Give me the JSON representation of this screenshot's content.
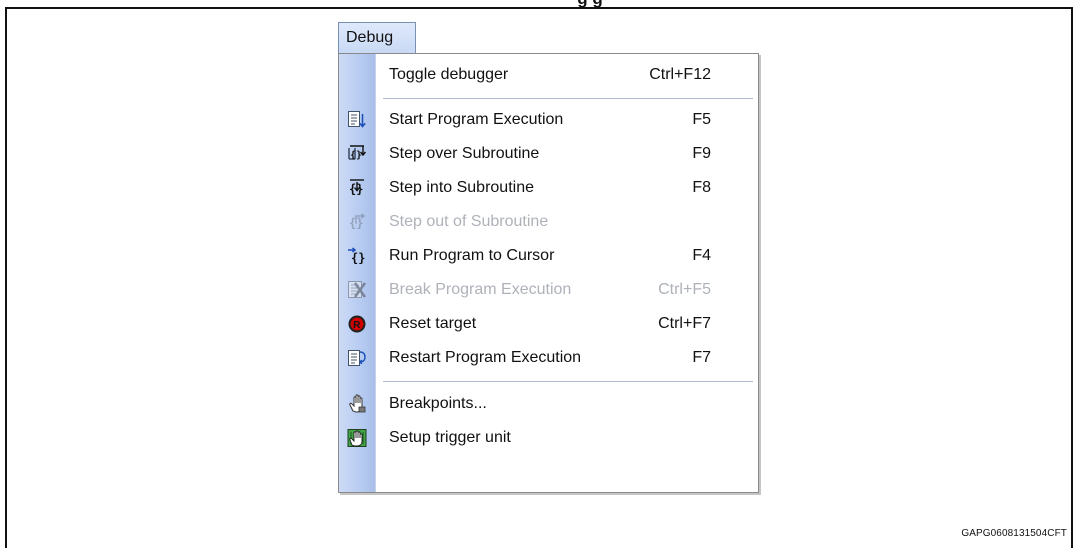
{
  "figure": {
    "top_text": "g   g",
    "caption": "GAPG0608131504CFT"
  },
  "menu": {
    "title": "Debug",
    "items": [
      {
        "label": "Toggle debugger",
        "shortcut": "Ctrl+F12",
        "enabled": true,
        "icon": ""
      },
      {
        "label": "Start Program Execution",
        "shortcut": "F5",
        "enabled": true,
        "icon": "start-execution-icon"
      },
      {
        "label": "Step over Subroutine",
        "shortcut": "F9",
        "enabled": true,
        "icon": "step-over-icon"
      },
      {
        "label": "Step into Subroutine",
        "shortcut": "F8",
        "enabled": true,
        "icon": "step-into-icon"
      },
      {
        "label": "Step out of Subroutine",
        "shortcut": "",
        "enabled": false,
        "icon": "step-out-icon"
      },
      {
        "label": "Run Program to Cursor",
        "shortcut": "F4",
        "enabled": true,
        "icon": "run-to-cursor-icon"
      },
      {
        "label": "Break Program Execution",
        "shortcut": "Ctrl+F5",
        "enabled": false,
        "icon": "break-execution-icon"
      },
      {
        "label": "Reset target",
        "shortcut": "Ctrl+F7",
        "enabled": true,
        "icon": "reset-target-icon"
      },
      {
        "label": "Restart Program Execution",
        "shortcut": "F7",
        "enabled": true,
        "icon": "restart-execution-icon"
      },
      {
        "label": "Breakpoints...",
        "shortcut": "",
        "enabled": true,
        "icon": "breakpoints-icon"
      },
      {
        "label": "Setup trigger unit",
        "shortcut": "",
        "enabled": true,
        "icon": "setup-trigger-unit-icon"
      }
    ]
  },
  "colors": {
    "menu_strip": "#b9cdf2",
    "separator": "#aebad4",
    "disabled_text": "#aeb2b9",
    "reset_red": "#d40000",
    "green_trigger": "#41a447"
  }
}
